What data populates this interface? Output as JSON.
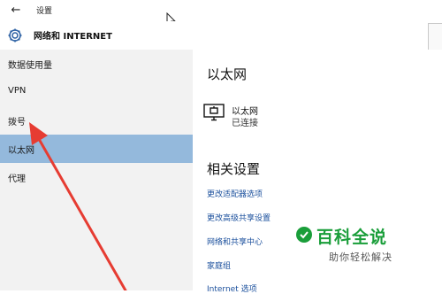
{
  "window": {
    "title": "设置"
  },
  "header": {
    "heading": "网络和 INTERNET"
  },
  "sidebar": {
    "items": [
      {
        "label": "数据使用量"
      },
      {
        "label": "VPN"
      },
      {
        "label": "拨号"
      },
      {
        "label": "以太网",
        "selected": true
      },
      {
        "label": "代理"
      }
    ]
  },
  "main": {
    "title": "以太网",
    "connection": {
      "name": "以太网",
      "status": "已连接",
      "icon": "monitor-network-icon"
    },
    "related_title": "相关设置",
    "links": [
      {
        "label": "更改适配器选项"
      },
      {
        "label": "更改高级共享设置"
      },
      {
        "label": "网络和共享中心"
      },
      {
        "label": "家庭组"
      },
      {
        "label": "Internet 选项"
      }
    ]
  },
  "watermark": {
    "title": "百科全说",
    "subtitle": "助你轻松解决"
  },
  "colors": {
    "accent": "#2a5fa3",
    "selected_bg": "#94b9dc",
    "link": "#1a4f9c",
    "annotation_arrow": "#e63c32",
    "watermark_green": "#1a9e3a"
  }
}
